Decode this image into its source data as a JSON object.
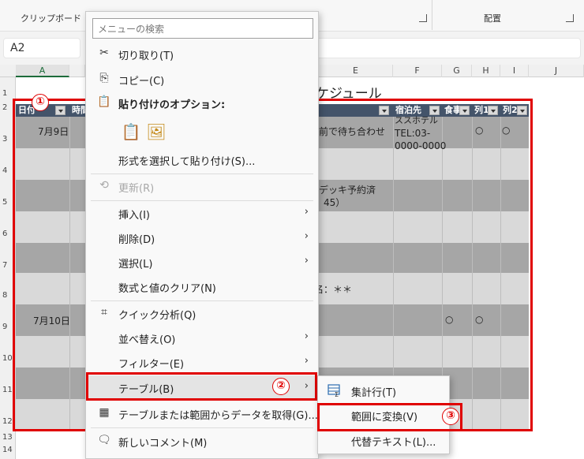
{
  "ribbon": {
    "clipboard_label": "クリップボード",
    "alignment_label": "配置"
  },
  "name_box": "A2",
  "columns": [
    "A",
    "",
    "",
    "",
    "E",
    "F",
    "G",
    "H",
    "I",
    "J"
  ],
  "rows": [
    "1",
    "2",
    "3",
    "4",
    "5",
    "6",
    "7",
    "8",
    "9",
    "10",
    "11",
    "12",
    "13",
    "14"
  ],
  "sheet": {
    "title_fragment": "ケジュール",
    "headers": {
      "date": "日付",
      "time": "時間",
      "hotel": "宿泊先",
      "meal": "食事",
      "col1": "列1",
      "col2": "列2"
    },
    "cells": {
      "date1": "7月9日",
      "date2": "7月10日",
      "meet": "前で待ち合わせ",
      "hotel_top": "ススホテル",
      "hotel_tel1": "TEL:03-",
      "hotel_tel2": "0000-0000",
      "circle_h3": "○",
      "circle_i3": "○",
      "deck": "デッキ予約済",
      "time45": "：45）",
      "name": "名：＊＊",
      "circle_g9": "○",
      "circle_h9": "○"
    }
  },
  "context_menu": {
    "search_placeholder": "メニューの検索",
    "cut": "切り取り(T)",
    "copy": "コピー(C)",
    "paste_options": "貼り付けのオプション:",
    "paste_special": "形式を選択して貼り付け(S)...",
    "refresh": "更新(R)",
    "insert": "挿入(I)",
    "delete": "削除(D)",
    "select": "選択(L)",
    "clear": "数式と値のクリア(N)",
    "quick_analysis": "クイック分析(Q)",
    "sort": "並べ替え(O)",
    "filter": "フィルター(E)",
    "table": "テーブル(B)",
    "get_data": "テーブルまたは範囲からデータを取得(G)...",
    "new_comment": "新しいコメント(M)"
  },
  "submenu": {
    "total_row": "集計行(T)",
    "convert_to_range": "範囲に変換(V)",
    "alt_text": "代替テキスト(L)..."
  },
  "badges": {
    "one": "①",
    "two": "②",
    "three": "③"
  },
  "colors": {
    "highlight": "#e00000",
    "table_header": "#44546a",
    "band_dark": "#a6a6a6",
    "band_light": "#d9d9d9"
  }
}
